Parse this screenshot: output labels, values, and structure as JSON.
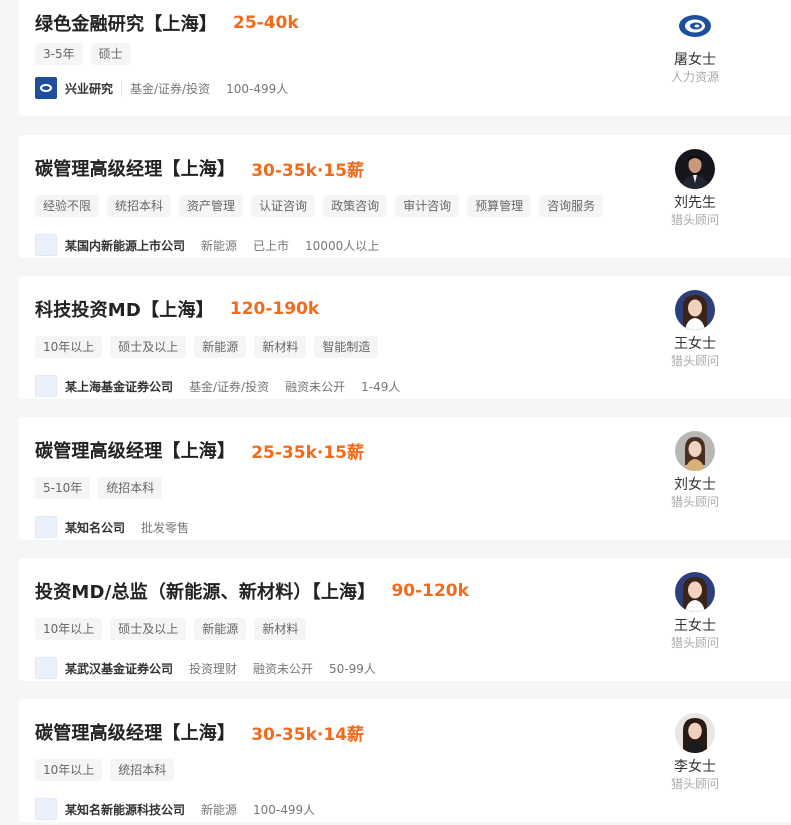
{
  "jobs": [
    {
      "title": "绿色金融研究【上海】",
      "salary": "25-40k",
      "tags": [
        "3-5年",
        "硕士"
      ],
      "company": "兴业研究",
      "meta": [
        "基金/证券/投资",
        "100-499人"
      ],
      "logo": "xingye-logo",
      "recruiter": {
        "name": "屠女士",
        "role": "人力资源",
        "avatar": "company-logo-avatar"
      }
    },
    {
      "title": "碳管理高级经理【上海】",
      "salary": "30-35k·15薪",
      "tags": [
        "经验不限",
        "统招本科",
        "资产管理",
        "认证咨询",
        "政策咨询",
        "审计咨询",
        "预算管理",
        "咨询服务"
      ],
      "company": "某国内新能源上市公司",
      "meta": [
        "新能源",
        "已上市",
        "10000人以上"
      ],
      "logo": "placeholder-logo",
      "recruiter": {
        "name": "刘先生",
        "role": "猎头顾问",
        "avatar": "male-avatar"
      }
    },
    {
      "title": "科技投资MD【上海】",
      "salary": "120-190k",
      "tags": [
        "10年以上",
        "硕士及以上",
        "新能源",
        "新材料",
        "智能制造"
      ],
      "company": "某上海基金证券公司",
      "meta": [
        "基金/证券/投资",
        "融资未公开",
        "1-49人"
      ],
      "logo": "placeholder-logo",
      "recruiter": {
        "name": "王女士",
        "role": "猎头顾问",
        "avatar": "female-avatar"
      }
    },
    {
      "title": "碳管理高级经理【上海】",
      "salary": "25-35k·15薪",
      "tags": [
        "5-10年",
        "统招本科"
      ],
      "company": "某知名公司",
      "meta": [
        "批发零售"
      ],
      "logo": "placeholder-logo",
      "recruiter": {
        "name": "刘女士",
        "role": "猎头顾问",
        "avatar": "female-avatar"
      }
    },
    {
      "title": "投资MD/总监（新能源、新材料）【上海】",
      "salary": "90-120k",
      "tags": [
        "10年以上",
        "硕士及以上",
        "新能源",
        "新材料"
      ],
      "company": "某武汉基金证券公司",
      "meta": [
        "投资理财",
        "融资未公开",
        "50-99人"
      ],
      "logo": "placeholder-logo",
      "recruiter": {
        "name": "王女士",
        "role": "猎头顾问",
        "avatar": "female-avatar"
      }
    },
    {
      "title": "碳管理高级经理【上海】",
      "salary": "30-35k·14薪",
      "tags": [
        "10年以上",
        "统招本科"
      ],
      "company": "某知名新能源科技公司",
      "meta": [
        "新能源",
        "100-499人"
      ],
      "logo": "placeholder-logo",
      "recruiter": {
        "name": "李女士",
        "role": "猎头顾问",
        "avatar": "female-avatar"
      }
    }
  ],
  "colors": {
    "salary": "#f26b1d",
    "background": "#f5f6f8",
    "card": "#ffffff",
    "tag_bg": "#f5f5f6",
    "xingye_blue": "#1f4f9c"
  }
}
